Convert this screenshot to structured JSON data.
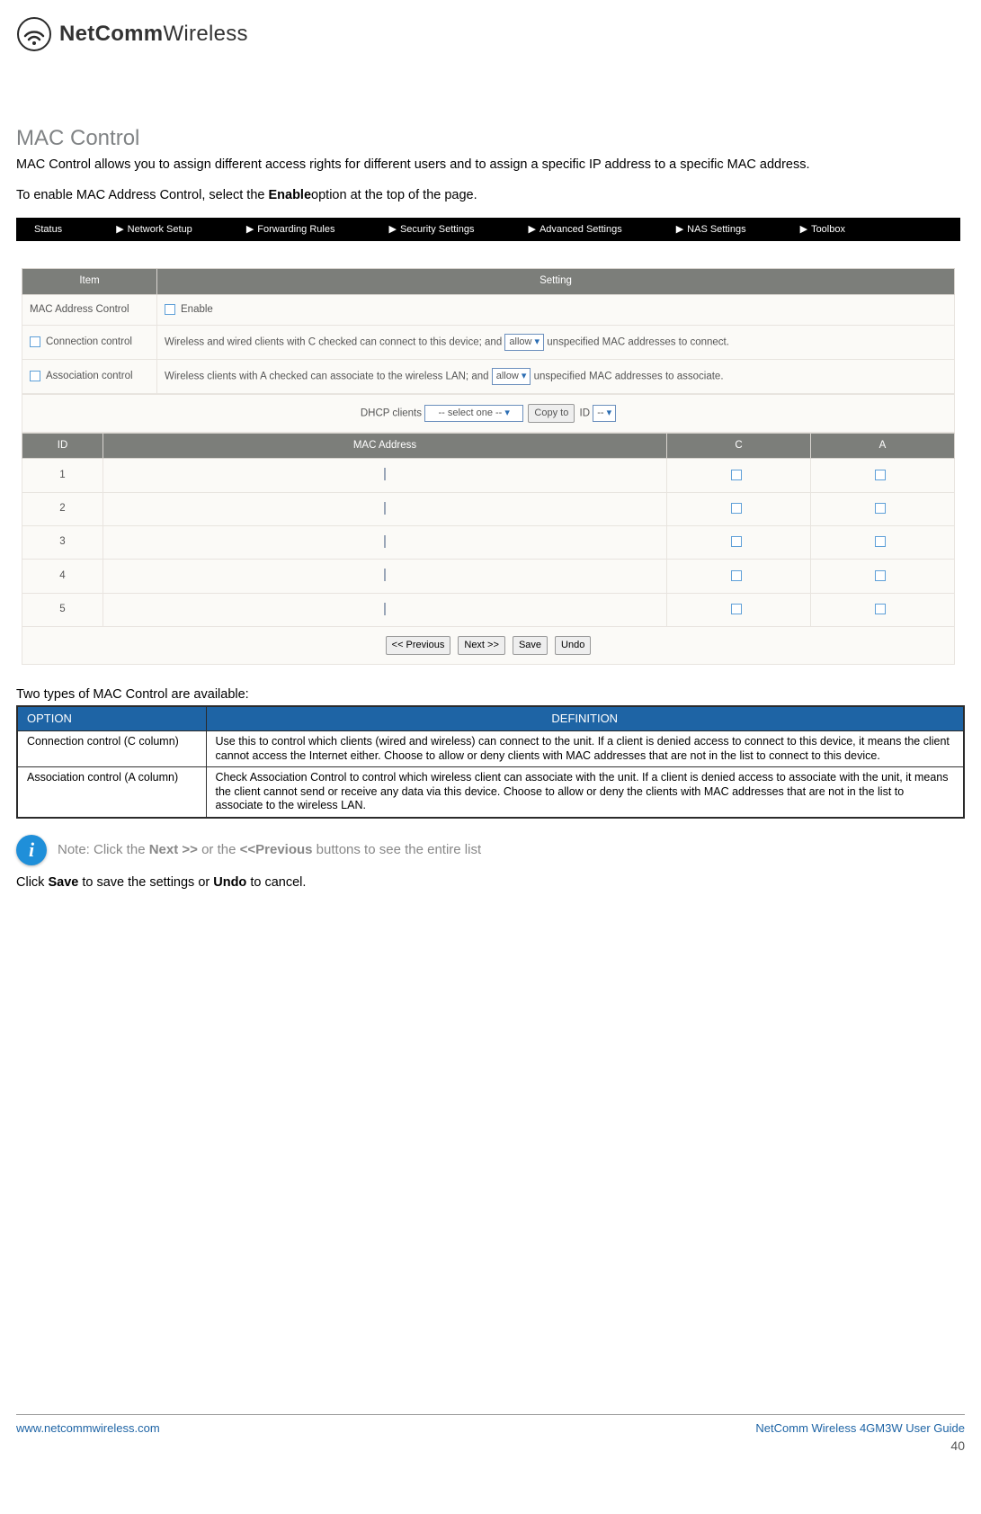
{
  "brand": {
    "name_bold": "NetComm",
    "name_light": "Wireless"
  },
  "section": {
    "title": "MAC Control",
    "intro": "MAC Control allows you to assign different access rights for different users and to assign a specific IP address to a specific MAC address.",
    "enable_lead": "To enable MAC Address Control, select the ",
    "enable_bold": "Enable",
    "enable_tail": "option at the top of the page."
  },
  "ui": {
    "nav": [
      "Status",
      "Network Setup",
      "Forwarding Rules",
      "Security Settings",
      "Advanced Settings",
      "NAS Settings",
      "Toolbox"
    ],
    "headers": {
      "item": "Item",
      "setting": "Setting"
    },
    "rows": {
      "mac": {
        "label": "MAC Address Control",
        "checkbox_label": "Enable"
      },
      "conn": {
        "label": "Connection control",
        "text_pre": "Wireless and wired clients with C checked can connect to this device; and ",
        "select": "allow",
        "text_post": " unspecified MAC addresses to connect."
      },
      "assoc": {
        "label": "Association control",
        "text_pre": "Wireless clients with A checked can associate to the wireless LAN; and ",
        "select": "allow",
        "text_post": " unspecified MAC addresses to associate."
      }
    },
    "dhcp": {
      "label": "DHCP clients",
      "select": "-- select one --",
      "copy_btn": "Copy to",
      "id_label": "ID",
      "id_select": "--"
    },
    "list": {
      "headers": {
        "id": "ID",
        "mac": "MAC Address",
        "c": "C",
        "a": "A"
      },
      "rows": [
        "1",
        "2",
        "3",
        "4",
        "5"
      ]
    },
    "buttons": {
      "prev": "<< Previous",
      "next": "Next >>",
      "save": "Save",
      "undo": "Undo"
    }
  },
  "def_intro": "Two types of MAC Control are available:",
  "def_table": {
    "headers": {
      "option": "OPTION",
      "definition": "DEFINITION"
    },
    "rows": [
      {
        "option": "Connection control (C column)",
        "definition": "Use this to control which clients (wired and wireless) can connect to the unit. If a client is denied access to connect to this device, it means the client cannot access the Internet either. Choose to allow or deny clients with MAC addresses that are not in the list to connect to this device."
      },
      {
        "option": "Association control (A column)",
        "definition": "Check Association Control to control which wireless client can associate with the unit. If a client is denied access to associate with the unit, it means the client cannot send or receive any data via this device. Choose to allow or deny the clients with MAC addresses that are not in the list to associate to the wireless LAN."
      }
    ]
  },
  "note": {
    "pre": "Note: Click the ",
    "bold1": "Next >>",
    "mid": " or the ",
    "bold2": "<<Previous",
    "post": " buttons to see the entire list"
  },
  "save_line": {
    "pre": "Click ",
    "save": "Save",
    "mid": " to save the settings or ",
    "undo": "Undo",
    "post": " to cancel."
  },
  "footer": {
    "url": "www.netcommwireless.com",
    "guide": "NetComm Wireless 4GM3W User Guide",
    "page": "40"
  }
}
